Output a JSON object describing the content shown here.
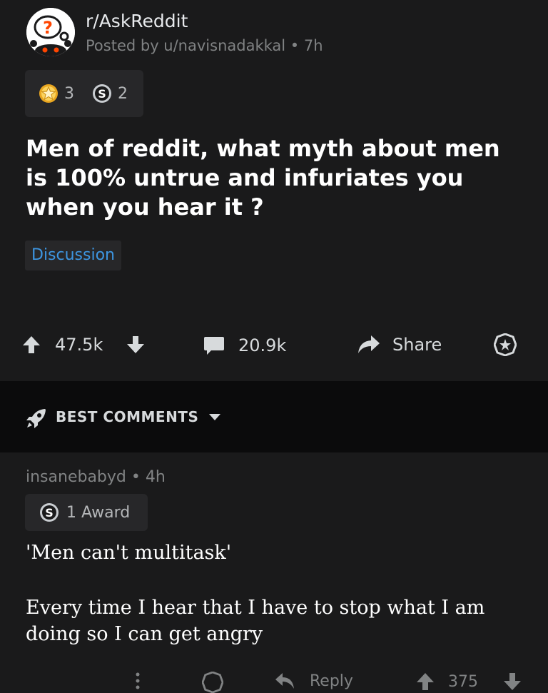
{
  "post": {
    "subreddit": "r/AskReddit",
    "posted_by": "Posted by u/navisnadakkal • 7h",
    "awards": [
      {
        "icon": "star-award-icon",
        "count": "3"
      },
      {
        "icon": "silver-coin-icon",
        "count": "2"
      }
    ],
    "title": "Men of reddit, what myth about men is 100% untrue and infuriates you when you hear it ?",
    "flair": "Discussion",
    "score": "47.5k",
    "comment_count": "20.9k",
    "share_label": "Share"
  },
  "comments_header": {
    "sort_label": "BEST COMMENTS"
  },
  "comment": {
    "meta": "insanebabyd • 4h",
    "award_label": "1 Award",
    "body_line1": "'Men can't multitask'",
    "body_line2": "Every time I hear that I have to stop what I am doing so I can get angry",
    "reply_label": "Reply",
    "score": "375"
  },
  "colors": {
    "background": "#1a1a1b",
    "band": "#0b0b0c",
    "flair_text": "#3d95e0",
    "muted": "#818384"
  }
}
